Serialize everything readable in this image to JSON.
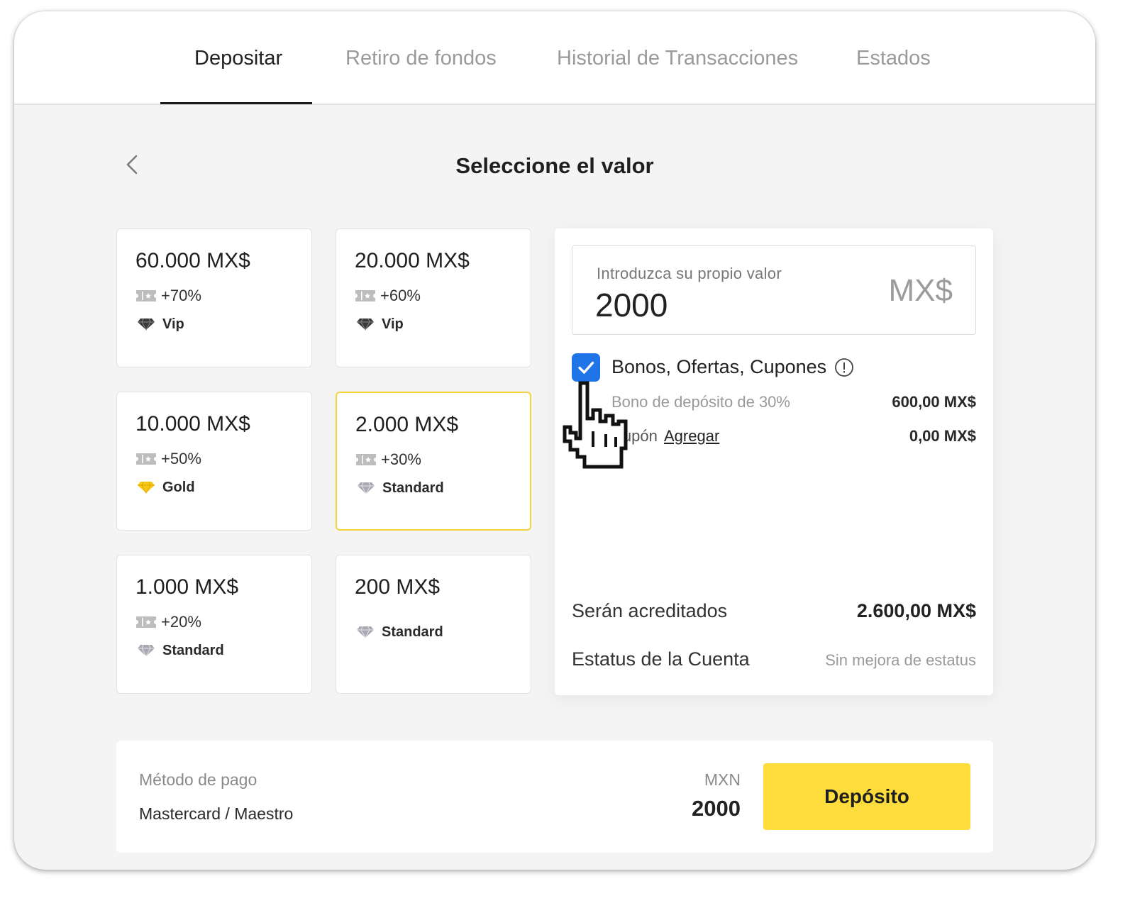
{
  "tabs": [
    {
      "label": "Depositar",
      "active": true
    },
    {
      "label": "Retiro de fondos"
    },
    {
      "label": "Historial de Transacciones"
    },
    {
      "label": "Estados"
    }
  ],
  "page_title": "Seleccione el valor",
  "cards": [
    {
      "amount": "60.000 MX$",
      "bonus": "+70%",
      "tier": "Vip",
      "tier_icon": "diamond-dark-icon"
    },
    {
      "amount": "20.000 MX$",
      "bonus": "+60%",
      "tier": "Vip",
      "tier_icon": "diamond-dark-icon"
    },
    {
      "amount": "10.000 MX$",
      "bonus": "+50%",
      "tier": "Gold",
      "tier_icon": "diamond-gold-icon"
    },
    {
      "amount": "2.000 MX$",
      "bonus": "+30%",
      "tier": "Standard",
      "tier_icon": "diamond-silver-icon",
      "selected": true
    },
    {
      "amount": "1.000 MX$",
      "bonus": "+20%",
      "tier": "Standard",
      "tier_icon": "diamond-silver-icon"
    },
    {
      "amount": "200 MX$",
      "bonus": "",
      "tier": "Standard",
      "tier_icon": "diamond-silver-icon"
    }
  ],
  "custom_value": {
    "label": "Introduzca su propio valor",
    "value": "2000",
    "currency": "MX$"
  },
  "bonuses": {
    "checked": true,
    "title": "Bonos, Ofertas, Cupones",
    "deposit_bonus_label": "Bono de depósito de 30%",
    "deposit_bonus_value": "600,00 MX$",
    "coupon_label": "Cupón",
    "coupon_link": "Agregar",
    "coupon_value": "0,00 MX$"
  },
  "summary": {
    "credited_label": "Serán acreditados",
    "credited_value": "2.600,00 MX$",
    "status_label": "Estatus de la Cuenta",
    "status_value": "Sin mejora de estatus"
  },
  "payment": {
    "label": "Método de pago",
    "method": "Mastercard / Maestro",
    "currency": "MXN",
    "amount": "2000",
    "button_label": "Depósito"
  },
  "colors": {
    "accent": "#fddc3c",
    "checkbox": "#1f74e8",
    "selected_border": "#f5d23c"
  }
}
